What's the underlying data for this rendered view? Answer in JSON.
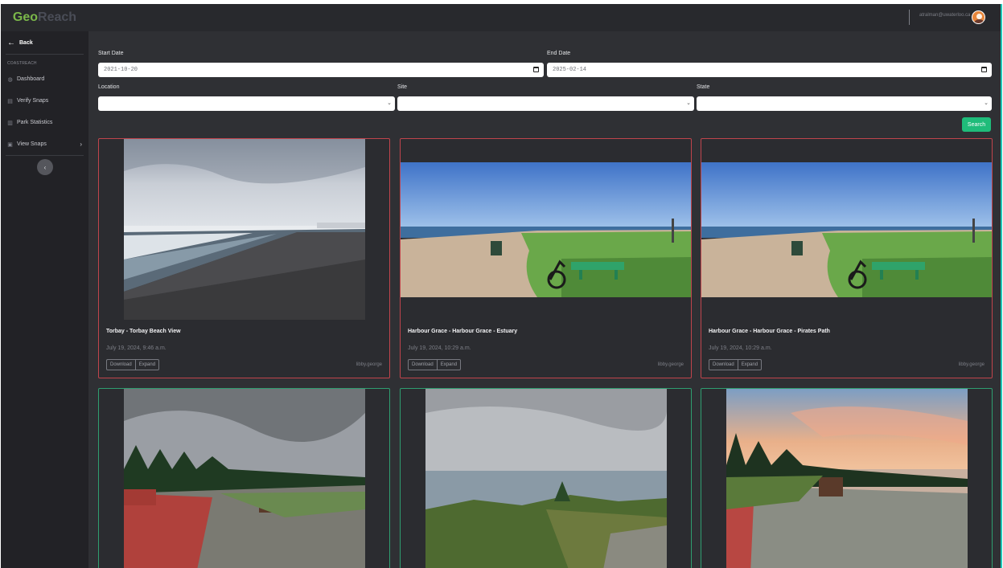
{
  "brand": {
    "part1": "Geo",
    "part2": "Reach"
  },
  "sidebar": {
    "back_label": "Back",
    "section_label": "COASTREACH",
    "items": [
      {
        "label": "Dashboard",
        "icon": "dashboard-icon"
      },
      {
        "label": "Verify Snaps",
        "icon": "verify-icon"
      },
      {
        "label": "Park Statistics",
        "icon": "chart-icon"
      },
      {
        "label": "View Snaps",
        "icon": "photo-icon",
        "has_submenu": true
      }
    ]
  },
  "topbar": {
    "user_email": "atralman@uwaterloo.ca"
  },
  "filters": {
    "start_date_label": "Start Date",
    "start_date_value": "2021-10-20",
    "end_date_label": "End Date",
    "end_date_value": "2025-02-14",
    "location_label": "Location",
    "site_label": "Site",
    "state_label": "State",
    "search_label": "Search"
  },
  "cards": [
    {
      "title": "Torbay - Torbay Beach View",
      "date": "July 19, 2024, 9:46 a.m.",
      "author": "libby.george",
      "download": "Download",
      "expand": "Expand",
      "status": "red"
    },
    {
      "title": "Harbour Grace - Harbour Grace - Estuary",
      "date": "July 19, 2024, 10:29 a.m.",
      "author": "libby.george",
      "download": "Download",
      "expand": "Expand",
      "status": "red"
    },
    {
      "title": "Harbour Grace - Harbour Grace - Pirates Path",
      "date": "July 19, 2024, 10:29 a.m.",
      "author": "libby.george",
      "download": "Download",
      "expand": "Expand",
      "status": "red"
    },
    {
      "status": "green"
    },
    {
      "status": "green"
    },
    {
      "status": "green"
    }
  ],
  "colors": {
    "accent_green": "#1fbc7a",
    "brand_green": "#7bb84a",
    "card_border_red": "#c0444c",
    "card_border_green": "#2f9e70"
  }
}
